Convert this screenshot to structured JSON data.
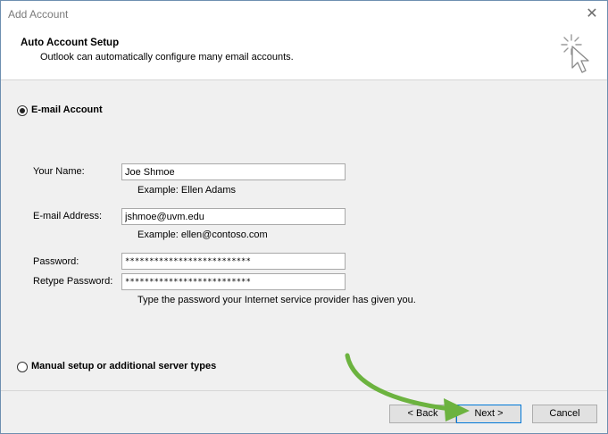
{
  "window": {
    "title": "Add Account",
    "close_icon": "close-icon"
  },
  "header": {
    "title": "Auto Account Setup",
    "subtitle": "Outlook can automatically configure many email accounts.",
    "icon": "wizard-cursor-icon"
  },
  "options": {
    "email_account": {
      "label": "E-mail Account",
      "selected": true
    },
    "manual_setup": {
      "label": "Manual setup or additional server types",
      "selected": false
    }
  },
  "form": {
    "name": {
      "label": "Your Name:",
      "value": "Joe Shmoe",
      "hint": "Example: Ellen Adams"
    },
    "email": {
      "label": "E-mail Address:",
      "value": "jshmoe@uvm.edu",
      "hint": "Example: ellen@contoso.com"
    },
    "password": {
      "label": "Password:",
      "value": "**************************"
    },
    "retype": {
      "label": "Retype Password:",
      "value": "**************************"
    },
    "password_hint": "Type the password your Internet service provider has given you."
  },
  "buttons": {
    "back": "< Back",
    "next": "Next >",
    "cancel": "Cancel"
  },
  "annotation": {
    "arrow_color": "#6cb33f"
  }
}
